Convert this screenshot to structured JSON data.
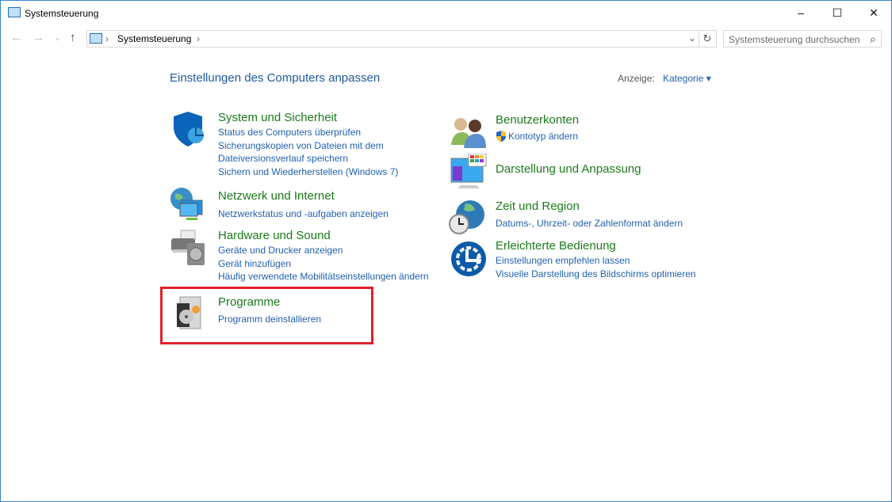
{
  "window": {
    "title": "Systemsteuerung",
    "minimize": "–",
    "maximize": "☐",
    "close": "✕"
  },
  "nav": {
    "back": "←",
    "forward": "→",
    "recent": "⌄",
    "up": "↑",
    "breadcrumb": "Systemsteuerung",
    "sep1": "›",
    "sep2": "›",
    "dropdown": "⌄",
    "refresh": "↻",
    "search_placeholder": "Systemsteuerung durchsuchen",
    "search_icon": "⌕"
  },
  "main": {
    "heading": "Einstellungen des Computers anpassen",
    "view_label": "Anzeige:",
    "view_value": "Kategorie",
    "view_caret": "▾",
    "categories": [
      {
        "title": "System und Sicherheit",
        "links": [
          "Status des Computers überprüfen",
          "Sicherungskopien von Dateien mit dem Dateiversionsverlauf speichern",
          "Sichern und Wiederherstellen (Windows 7)"
        ],
        "icon": "shield-icon"
      },
      {
        "title": "Netzwerk und Internet",
        "links": [
          "Netzwerkstatus und -aufgaben anzeigen"
        ],
        "icon": "network-icon"
      },
      {
        "title": "Hardware und Sound",
        "links": [
          "Geräte und Drucker anzeigen",
          "Gerät hinzufügen",
          "Häufig verwendete Mobilitätseinstellungen ändern"
        ],
        "icon": "printer-icon"
      },
      {
        "title": "Programme",
        "links": [
          "Programm deinstallieren"
        ],
        "icon": "programs-icon"
      },
      {
        "title": "Benutzerkonten",
        "links": [
          "Kontotyp ändern"
        ],
        "icon": "users-icon"
      },
      {
        "title": "Darstellung und Anpassung",
        "links": [],
        "icon": "display-icon"
      },
      {
        "title": "Zeit und Region",
        "links": [
          "Datums-, Uhrzeit- oder Zahlenformat ändern"
        ],
        "icon": "clock-globe-icon"
      },
      {
        "title": "Erleichterte Bedienung",
        "links": [
          "Einstellungen empfehlen lassen",
          "Visuelle Darstellung des Bildschirms optimieren"
        ],
        "icon": "accessibility-icon"
      }
    ]
  },
  "colors": {
    "highlight": "#e0202a",
    "link": "#1f61b0",
    "category_title": "#1a7b1a"
  }
}
